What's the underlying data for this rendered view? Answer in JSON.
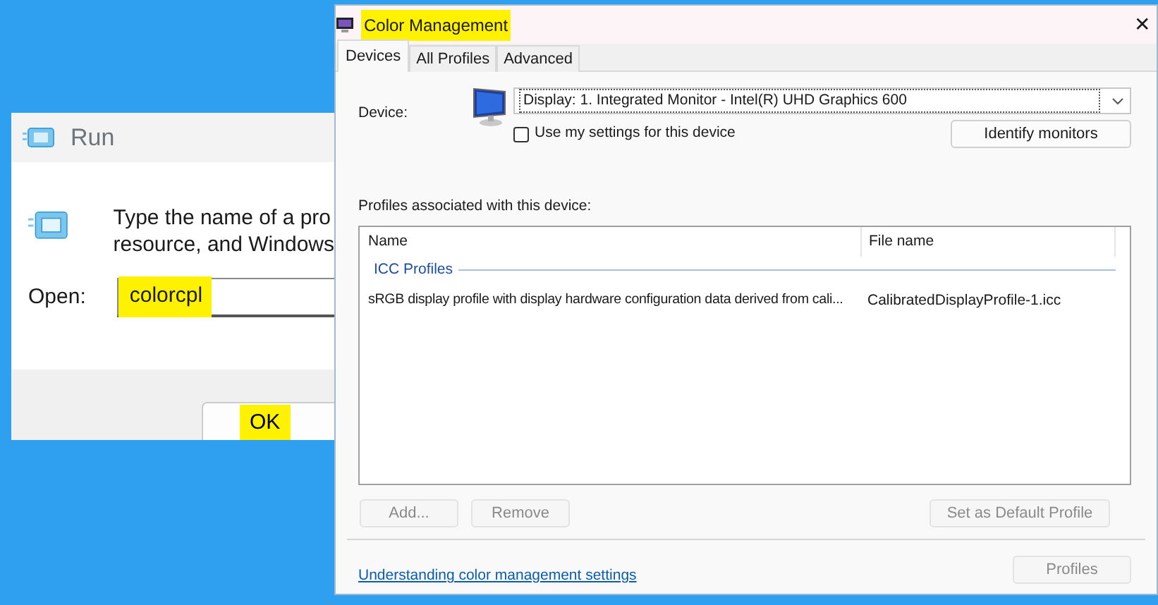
{
  "run_dialog": {
    "title": "Run",
    "message_lines": [
      "Type the name of a pro",
      "resource, and Windows"
    ],
    "open_label": "Open:",
    "open_value": "colorcpl",
    "open_value_highlighted": true,
    "ok_button": {
      "label": "OK",
      "highlighted": true
    }
  },
  "color_management": {
    "title": "Color Management",
    "title_highlighted": true,
    "close": "✕",
    "tabs": [
      {
        "label": "Devices",
        "selected": true
      },
      {
        "label": "All Profiles",
        "selected": false
      },
      {
        "label": "Advanced",
        "selected": false
      }
    ],
    "device_label": "Device:",
    "device_value": "Display: 1. Integrated Monitor - Intel(R) UHD Graphics 600",
    "use_my_settings": {
      "label": "Use my settings for this device",
      "checked": false
    },
    "identify_button": {
      "label": "Identify monitors",
      "disabled": false
    },
    "profiles_label": "Profiles associated with this device:",
    "table": {
      "columns": [
        "Name",
        "File name"
      ],
      "group": "ICC Profiles",
      "rows": [
        {
          "name": "sRGB display profile with display hardware configuration data derived from cali...",
          "file_name": "CalibratedDisplayProfile-1.icc"
        }
      ]
    },
    "buttons": [
      {
        "label": "Add...",
        "disabled": true
      },
      {
        "label": "Remove",
        "disabled": true
      },
      {
        "label": "Set as Default Profile",
        "disabled": true
      }
    ],
    "link": "Understanding color management settings",
    "profiles_button": {
      "label": "Profiles",
      "disabled": true
    }
  }
}
